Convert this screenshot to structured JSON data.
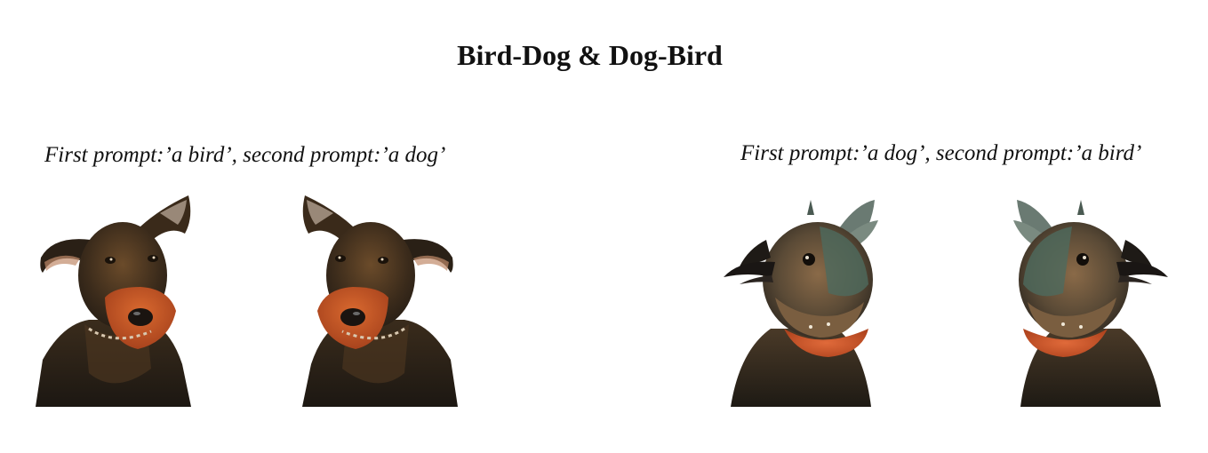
{
  "page": {
    "title": "Bird-Dog & Dog-Bird"
  },
  "panels": [
    {
      "caption": "First prompt:’a bird’, second prompt:’a dog’",
      "images": [
        {
          "subject": "dog-with-bird-feathers",
          "orientation": "original"
        },
        {
          "subject": "dog-with-bird-feathers",
          "orientation": "mirrored"
        }
      ]
    },
    {
      "caption": "First prompt:’a dog’, second prompt:’a bird’",
      "images": [
        {
          "subject": "bird-with-dog-body",
          "orientation": "original"
        },
        {
          "subject": "bird-with-dog-body",
          "orientation": "mirrored"
        }
      ]
    }
  ],
  "colors": {
    "background": "#ffffff",
    "fur_dark": "#2a2218",
    "fur_brown": "#6a4a2a",
    "beard_orange": "#c8582a",
    "feather_teal": "#4e6a5e",
    "feather_orange": "#c8522c"
  }
}
